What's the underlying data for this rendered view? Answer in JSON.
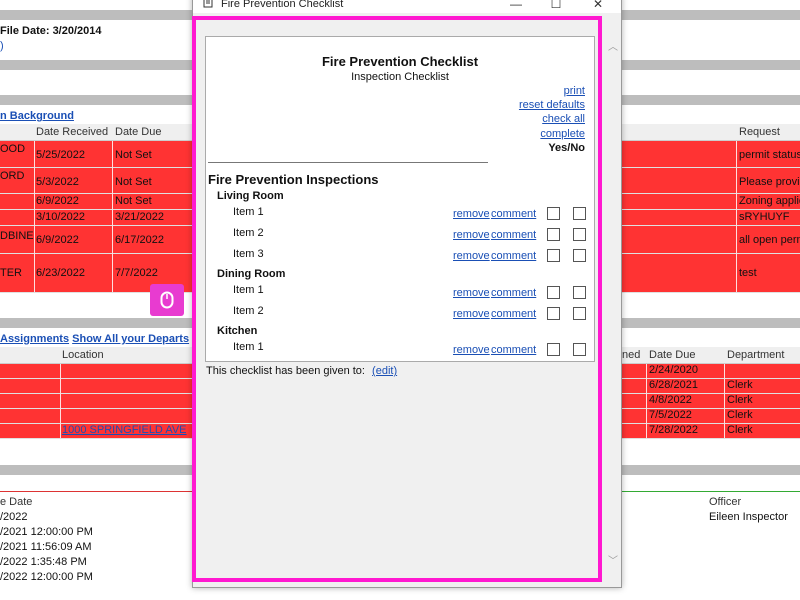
{
  "background": {
    "file_date": "File Date: 3/20/2014",
    "background_link": "n Background",
    "req_columns": [
      "Date Received",
      "Date Due",
      "Request"
    ],
    "req_rows": [
      {
        "name": "OOD",
        "received": "5/25/2022",
        "due": "Not Set",
        "request": "permit status"
      },
      {
        "name": "ORD",
        "received": "5/3/2022",
        "due": "Not Set",
        "request": "Please provid"
      },
      {
        "name": "",
        "received": "6/9/2022",
        "due": "Not Set",
        "request": "Zoning applic"
      },
      {
        "name": "",
        "received": "3/10/2022",
        "due": "3/21/2022",
        "request": "sRYHUYF"
      },
      {
        "name": "DBINE",
        "received": "6/9/2022",
        "due": "6/17/2022",
        "request": "all open perm"
      },
      {
        "name": "TER",
        "received": "6/23/2022",
        "due": "7/7/2022",
        "request": "test"
      }
    ],
    "assignments_link": "Assignments",
    "show_all_link": "Show All your Departs",
    "assign_columns": {
      "location": "Location",
      "assigned": "ned",
      "due": "Date Due",
      "department": "Department"
    },
    "assign_rows": [
      {
        "location": "",
        "due": "2/24/2020",
        "department": ""
      },
      {
        "location": "",
        "due": "6/28/2021",
        "department": "Clerk"
      },
      {
        "location": "",
        "due": "4/8/2022",
        "department": "Clerk"
      },
      {
        "location": "",
        "due": "7/5/2022",
        "department": "Clerk"
      },
      {
        "location": "1000 SPRINGFIELD AVE",
        "due": "7/28/2022",
        "department": "Clerk"
      }
    ],
    "insp_columns": {
      "date": "e Date",
      "officer": "Officer"
    },
    "insp_rows": [
      {
        "date": "/2022",
        "officer": "Eileen Inspector"
      },
      {
        "date": "/2021 12:00:00 PM",
        "officer": ""
      },
      {
        "date": "/2021 11:56:09 AM",
        "officer": ""
      },
      {
        "date": "/2022 1:35:48 PM",
        "officer": ""
      },
      {
        "date": "/2022 12:00:00 PM",
        "officer": ""
      }
    ]
  },
  "window": {
    "title": "Fire Prevention Checklist",
    "minimize": "—",
    "maximize": "☐",
    "close": "✕"
  },
  "checklist": {
    "title": "Fire Prevention Checklist",
    "subtitle": "Inspection Checklist",
    "links": {
      "print": "print",
      "reset": "reset defaults",
      "check_all": "check all",
      "complete": "complete"
    },
    "yes_no": "Yes/No",
    "section_title": "Fire Prevention Inspections",
    "remove_label": "remove",
    "comment_label": "comment",
    "rooms": [
      {
        "name": "Living Room",
        "items": [
          "Item 1",
          "Item 2",
          "Item 3"
        ]
      },
      {
        "name": "Dining Room",
        "items": [
          "Item 1",
          "Item 2"
        ]
      },
      {
        "name": "Kitchen",
        "items": [
          "Item 1"
        ]
      }
    ]
  },
  "given_to": {
    "label": "This checklist has been given to:",
    "edit": "(edit)"
  }
}
